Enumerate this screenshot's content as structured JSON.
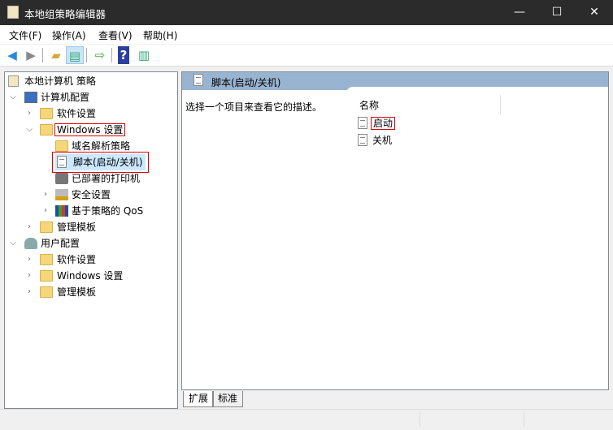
{
  "window": {
    "title": "本地组策略编辑器",
    "minimize": "—",
    "maximize": "☐",
    "close": "✕"
  },
  "menu": [
    "文件(F)",
    "操作(A)",
    "查看(V)",
    "帮助(H)"
  ],
  "toolbar": {
    "back": "back-icon",
    "forward": "forward-icon",
    "up": "up-folder-icon",
    "show_hide_tree": "console-tree-icon",
    "export": "export-list-icon",
    "help": "help-icon",
    "action_pane": "action-pane-icon"
  },
  "tree": {
    "root": "本地计算机 策略",
    "computer": "计算机配置",
    "c_software": "软件设置",
    "c_windows": "Windows 设置",
    "dns": "域名解析策略",
    "scripts": "脚本(启动/关机)",
    "printers": "已部署的打印机",
    "security": "安全设置",
    "qos": "基于策略的 QoS",
    "c_admin": "管理模板",
    "user": "用户配置",
    "u_software": "软件设置",
    "u_windows": "Windows 设置",
    "u_admin": "管理模板"
  },
  "details": {
    "header": "脚本(启动/关机)",
    "description": "选择一个项目来查看它的描述。",
    "column_name": "名称",
    "items": [
      "启动",
      "关机"
    ]
  },
  "tabs": [
    "扩展",
    "标准"
  ]
}
